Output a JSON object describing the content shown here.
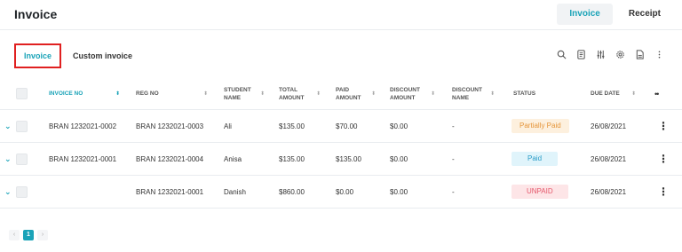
{
  "header": {
    "title": "Invoice",
    "tabs": [
      {
        "label": "Invoice",
        "active": true
      },
      {
        "label": "Receipt",
        "active": false
      }
    ]
  },
  "subtabs": [
    {
      "label": "Invoice",
      "active": true
    },
    {
      "label": "Custom invoice",
      "active": false
    }
  ],
  "toolbar": {
    "icons": [
      "search-icon",
      "document-list-icon",
      "sliders-icon",
      "gear-icon",
      "export-document-icon",
      "more-vertical-icon"
    ]
  },
  "table": {
    "columns": [
      {
        "key": "invoice_no",
        "label": "INVOICE NO",
        "sortable": true,
        "sorted": true
      },
      {
        "key": "reg_no",
        "label": "REG NO",
        "sortable": true
      },
      {
        "key": "student_name",
        "label": "STUDENT NAME",
        "sortable": true
      },
      {
        "key": "total_amount",
        "label": "TOTAL AMOUNT",
        "sortable": true
      },
      {
        "key": "paid_amount",
        "label": "PAID AMOUNT",
        "sortable": true
      },
      {
        "key": "discount_amount",
        "label": "DISCOUNT AMOUNT",
        "sortable": true
      },
      {
        "key": "discount_name",
        "label": "DISCOUNT NAME",
        "sortable": true
      },
      {
        "key": "status",
        "label": "STATUS",
        "sortable": false
      },
      {
        "key": "due_date",
        "label": "DUE DATE",
        "sortable": true
      }
    ],
    "rows": [
      {
        "invoice_no": "BRAN 1232021-0002",
        "reg_no": "BRAN 1232021-0003",
        "student_name": "Ali",
        "total_amount": "$135.00",
        "paid_amount": "$70.00",
        "discount_amount": "$0.00",
        "discount_name": "-",
        "status": "Partially Paid",
        "status_kind": "partial",
        "due_date": "26/08/2021"
      },
      {
        "invoice_no": "BRAN 1232021-0001",
        "reg_no": "BRAN 1232021-0004",
        "student_name": "Anisa",
        "total_amount": "$135.00",
        "paid_amount": "$135.00",
        "discount_amount": "$0.00",
        "discount_name": "-",
        "status": "Paid",
        "status_kind": "paid",
        "due_date": "26/08/2021"
      },
      {
        "invoice_no": "",
        "reg_no": "BRAN 1232021-0001",
        "student_name": "Danish",
        "total_amount": "$860.00",
        "paid_amount": "$0.00",
        "discount_amount": "$0.00",
        "discount_name": "-",
        "status": "UNPAID",
        "status_kind": "unpaid",
        "due_date": "26/08/2021"
      }
    ]
  },
  "pagination": {
    "prev": "‹",
    "current": "1",
    "next": "›"
  },
  "colors": {
    "accent": "#1aa3b8",
    "highlight_border": "#e02020"
  }
}
